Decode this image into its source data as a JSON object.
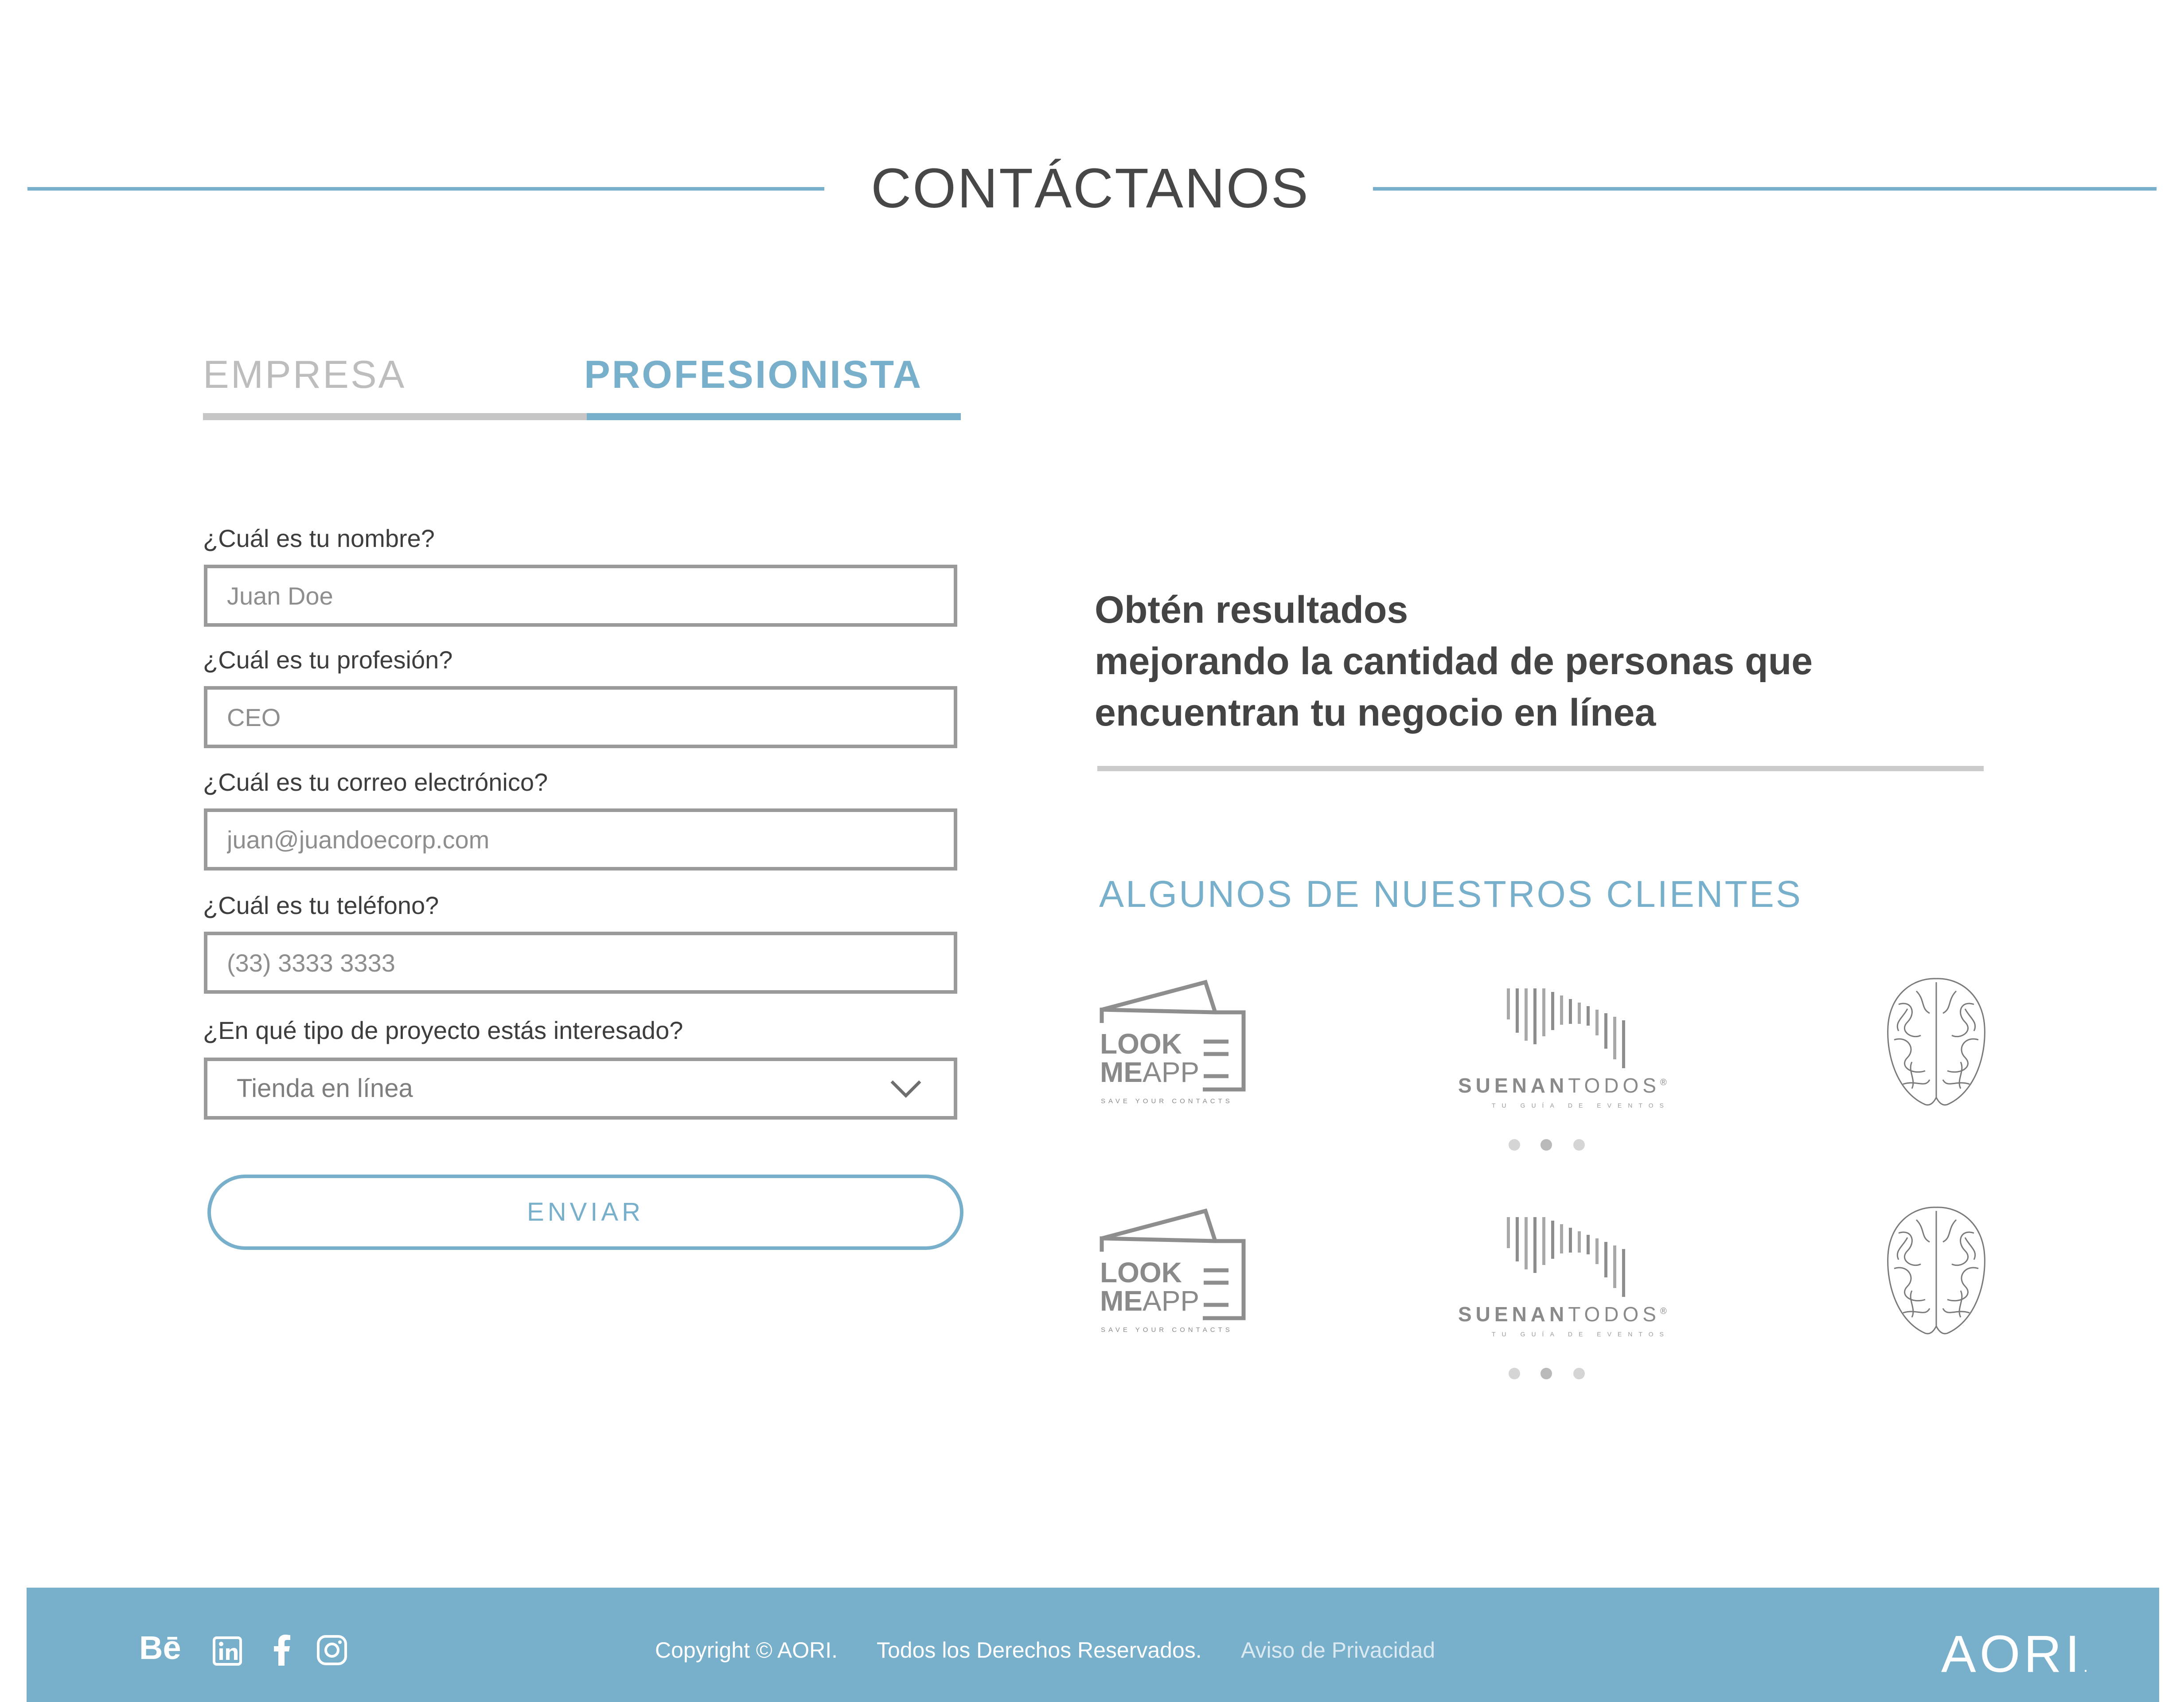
{
  "header": {
    "title": "CONTÁCTANOS",
    "line_color": "#78b0cc"
  },
  "tabs": [
    {
      "label": "EMPRESA",
      "active": false
    },
    {
      "label": "PROFESIONISTA",
      "active": true
    }
  ],
  "form": {
    "fields": [
      {
        "label": "¿Cuál es tu nombre?",
        "placeholder": "Juan Doe",
        "value": ""
      },
      {
        "label": "¿Cuál es tu profesión?",
        "placeholder": "CEO",
        "value": ""
      },
      {
        "label": "¿Cuál es tu correo electrónico?",
        "placeholder": "juan@juandoecorp.com",
        "value": ""
      },
      {
        "label": "¿Cuál es tu teléfono?",
        "placeholder": "(33) 3333 3333",
        "value": ""
      }
    ],
    "project": {
      "label": "¿En qué tipo de proyecto estás interesado?",
      "value": "Tienda en línea"
    },
    "submit_label": "ENVIAR"
  },
  "headline": {
    "lines": [
      "Obtén resultados",
      "mejorando la cantidad de personas que",
      "encuentran tu negocio en línea"
    ]
  },
  "clients": {
    "title": "ALGUNOS DE NUESTROS CLIENTES",
    "logos": {
      "lookme": {
        "line1": "LOOK",
        "line2a": "ME",
        "line2b": "APP",
        "tagline": "SAVE YOUR CONTACTS"
      },
      "suenan": {
        "name_bold": "SUENAN",
        "name_light": "TODOS",
        "mark": "®",
        "tagline": "TU GUÍA DE EVENTOS"
      },
      "brain": {
        "icon": "brain-icon"
      }
    },
    "carousel_rows": [
      {
        "active_dot": 2,
        "dots": 3
      },
      {
        "active_dot": 2,
        "dots": 3
      }
    ]
  },
  "footer": {
    "social": [
      "behance-icon",
      "linkedin-icon",
      "facebook-icon",
      "instagram-icon"
    ],
    "behance_text": "Bē",
    "copyright": "Copyright © AORI.",
    "rights": "Todos los Derechos Reservados.",
    "privacy": "Aviso de Privacidad",
    "brand": "AORI",
    "brand_mark": ".",
    "bg_color": "#78b0cc"
  },
  "colors": {
    "accent": "#78b0cc",
    "text": "#444444",
    "muted": "#bdbdbd",
    "border": "#9a9a9a"
  }
}
